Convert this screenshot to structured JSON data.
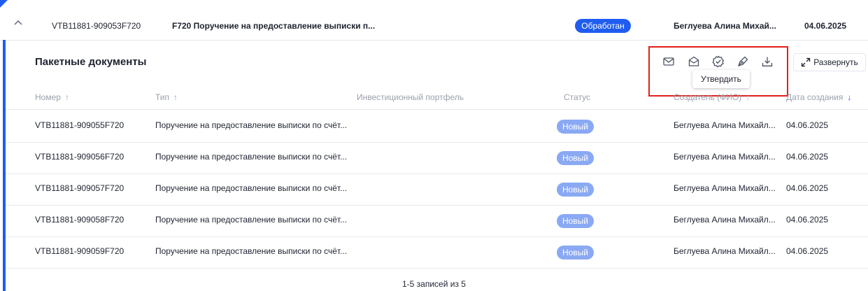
{
  "top_row": {
    "id": "VTB11881-909053F720",
    "type": "F720 Поручение на предоставление выписки п...",
    "status": "Обработан",
    "author": "Беглуева Алина Михай...",
    "date": "04.06.2025"
  },
  "section": {
    "title": "Пакетные документы",
    "expand_label": "Развернуть",
    "tooltip": "Утвердить"
  },
  "toolbar_icons": [
    "mail-icon",
    "open-mail-icon",
    "approve-icon",
    "sign-pen-icon",
    "download-icon"
  ],
  "columns": {
    "number": "Номер",
    "type": "Тип",
    "portfolio": "Инвестиционный портфель",
    "status": "Статус",
    "creator": "Создатель (ФИО)",
    "created": "Дата создания"
  },
  "rows": [
    {
      "number": "VTB11881-909055F720",
      "type": "Поручение на предоставление выписки по счёт...",
      "status": "Новый",
      "creator": "Беглуева Алина Михайл...",
      "date": "04.06.2025"
    },
    {
      "number": "VTB11881-909056F720",
      "type": "Поручение на предоставление выписки по счёт...",
      "status": "Новый",
      "creator": "Беглуева Алина Михайл...",
      "date": "04.06.2025"
    },
    {
      "number": "VTB11881-909057F720",
      "type": "Поручение на предоставление выписки по счёт...",
      "status": "Новый",
      "creator": "Беглуева Алина Михайл...",
      "date": "04.06.2025"
    },
    {
      "number": "VTB11881-909058F720",
      "type": "Поручение на предоставление выписки по счёт...",
      "status": "Новый",
      "creator": "Беглуева Алина Михайл...",
      "date": "04.06.2025"
    },
    {
      "number": "VTB11881-909059F720",
      "type": "Поручение на предоставление выписки по счёт...",
      "status": "Новый",
      "creator": "Беглуева Алина Михайл...",
      "date": "04.06.2025"
    }
  ],
  "footer": "1-5 записей из 5",
  "colors": {
    "accent": "#1f5df0",
    "badge_new": "#8aa9f3",
    "highlight": "#e0201b"
  }
}
